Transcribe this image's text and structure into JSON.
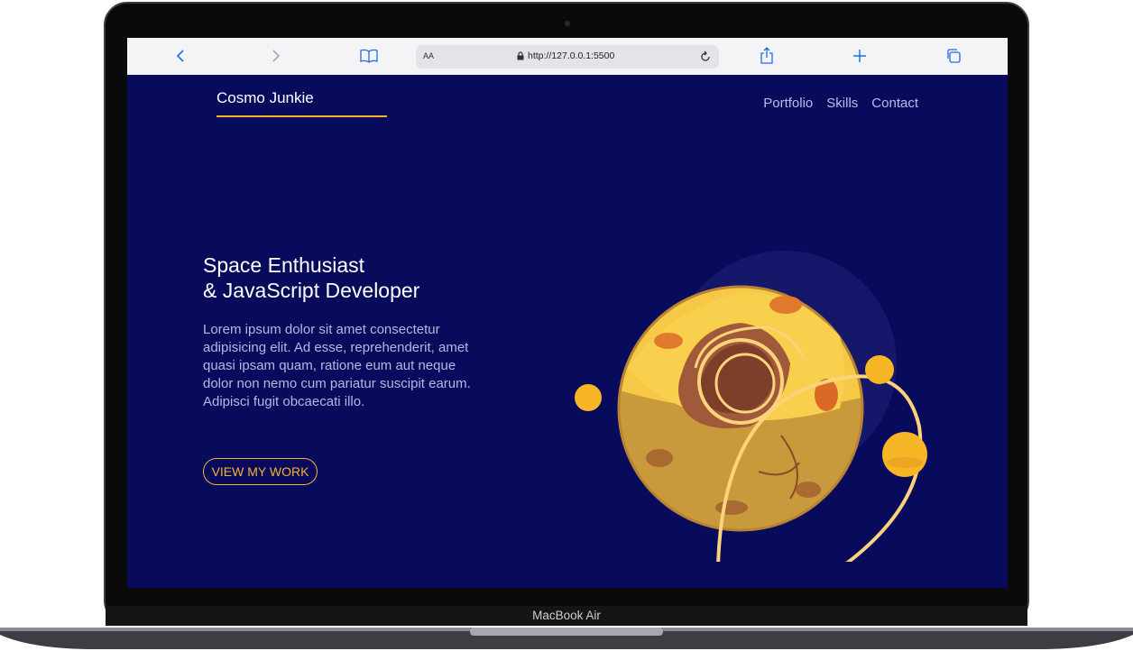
{
  "device": {
    "label": "MacBook Air"
  },
  "browser": {
    "reader_label": "AA",
    "url": "http://127.0.0.1:5500",
    "icons": [
      "chevron-left-icon",
      "chevron-right-icon",
      "book-icon",
      "lock-icon",
      "reload-icon",
      "share-icon",
      "plus-icon",
      "tabs-icon"
    ]
  },
  "site": {
    "logo": "Cosmo Junkie",
    "nav": [
      "Portfolio",
      "Skills",
      "Contact"
    ],
    "hero": {
      "title_line1": "Space Enthusiast",
      "title_line2": "& JavaScript Developer",
      "paragraph": "Lorem ipsum dolor sit amet consectetur adipisicing elit. Ad esse, reprehenderit, amet quasi ipsam quam, ratione eum aut neque dolor non nemo cum pariatur suscipit earum. Adipisci fugit obcaecati illo.",
      "cta": "VIEW MY WORK"
    },
    "colors": {
      "background": "#080a5c",
      "accent": "#f5b335",
      "text": "#b4b8e2"
    }
  }
}
